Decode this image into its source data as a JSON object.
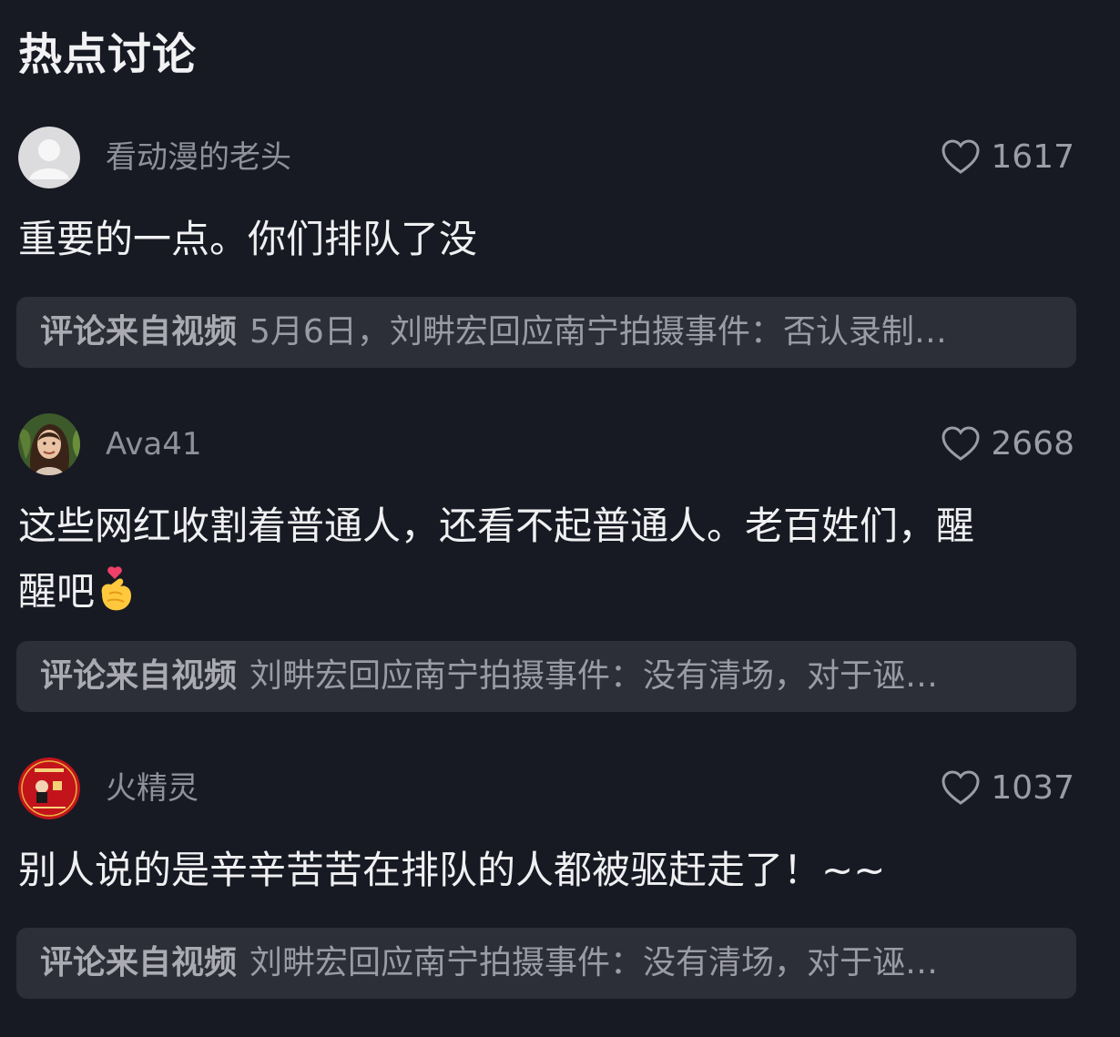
{
  "section_title": "热点讨论",
  "comments": [
    {
      "username": "看动漫的老头",
      "likes": "1617",
      "text": "重要的一点。你们排队了没",
      "source_label": "评论来自视频",
      "source_text": "5月6日，刘畊宏回应南宁拍摄事件：否认录制…",
      "avatar": "default-person-avatar"
    },
    {
      "username": "Ava41",
      "likes": "2668",
      "text_line1": "这些网红收割着普通人，还看不起普通人。老百姓们，醒",
      "text_line2": "醒吧",
      "emoji": "finger-heart-emoji",
      "source_label": "评论来自视频",
      "source_text": "刘畊宏回应南宁拍摄事件：没有清场，对于诬…",
      "avatar": "portrait-avatar"
    },
    {
      "username": "火精灵",
      "likes": "1037",
      "text": "别人说的是辛辛苦苦在排队的人都被驱赶走了！~~",
      "source_label": "评论来自视频",
      "source_text": "刘畊宏回应南宁拍摄事件：没有清场，对于诬…",
      "avatar": "red-seal-avatar"
    }
  ],
  "colors": {
    "background": "#171a23",
    "card": "#2c2e38",
    "muted_text": "#8e909a"
  }
}
